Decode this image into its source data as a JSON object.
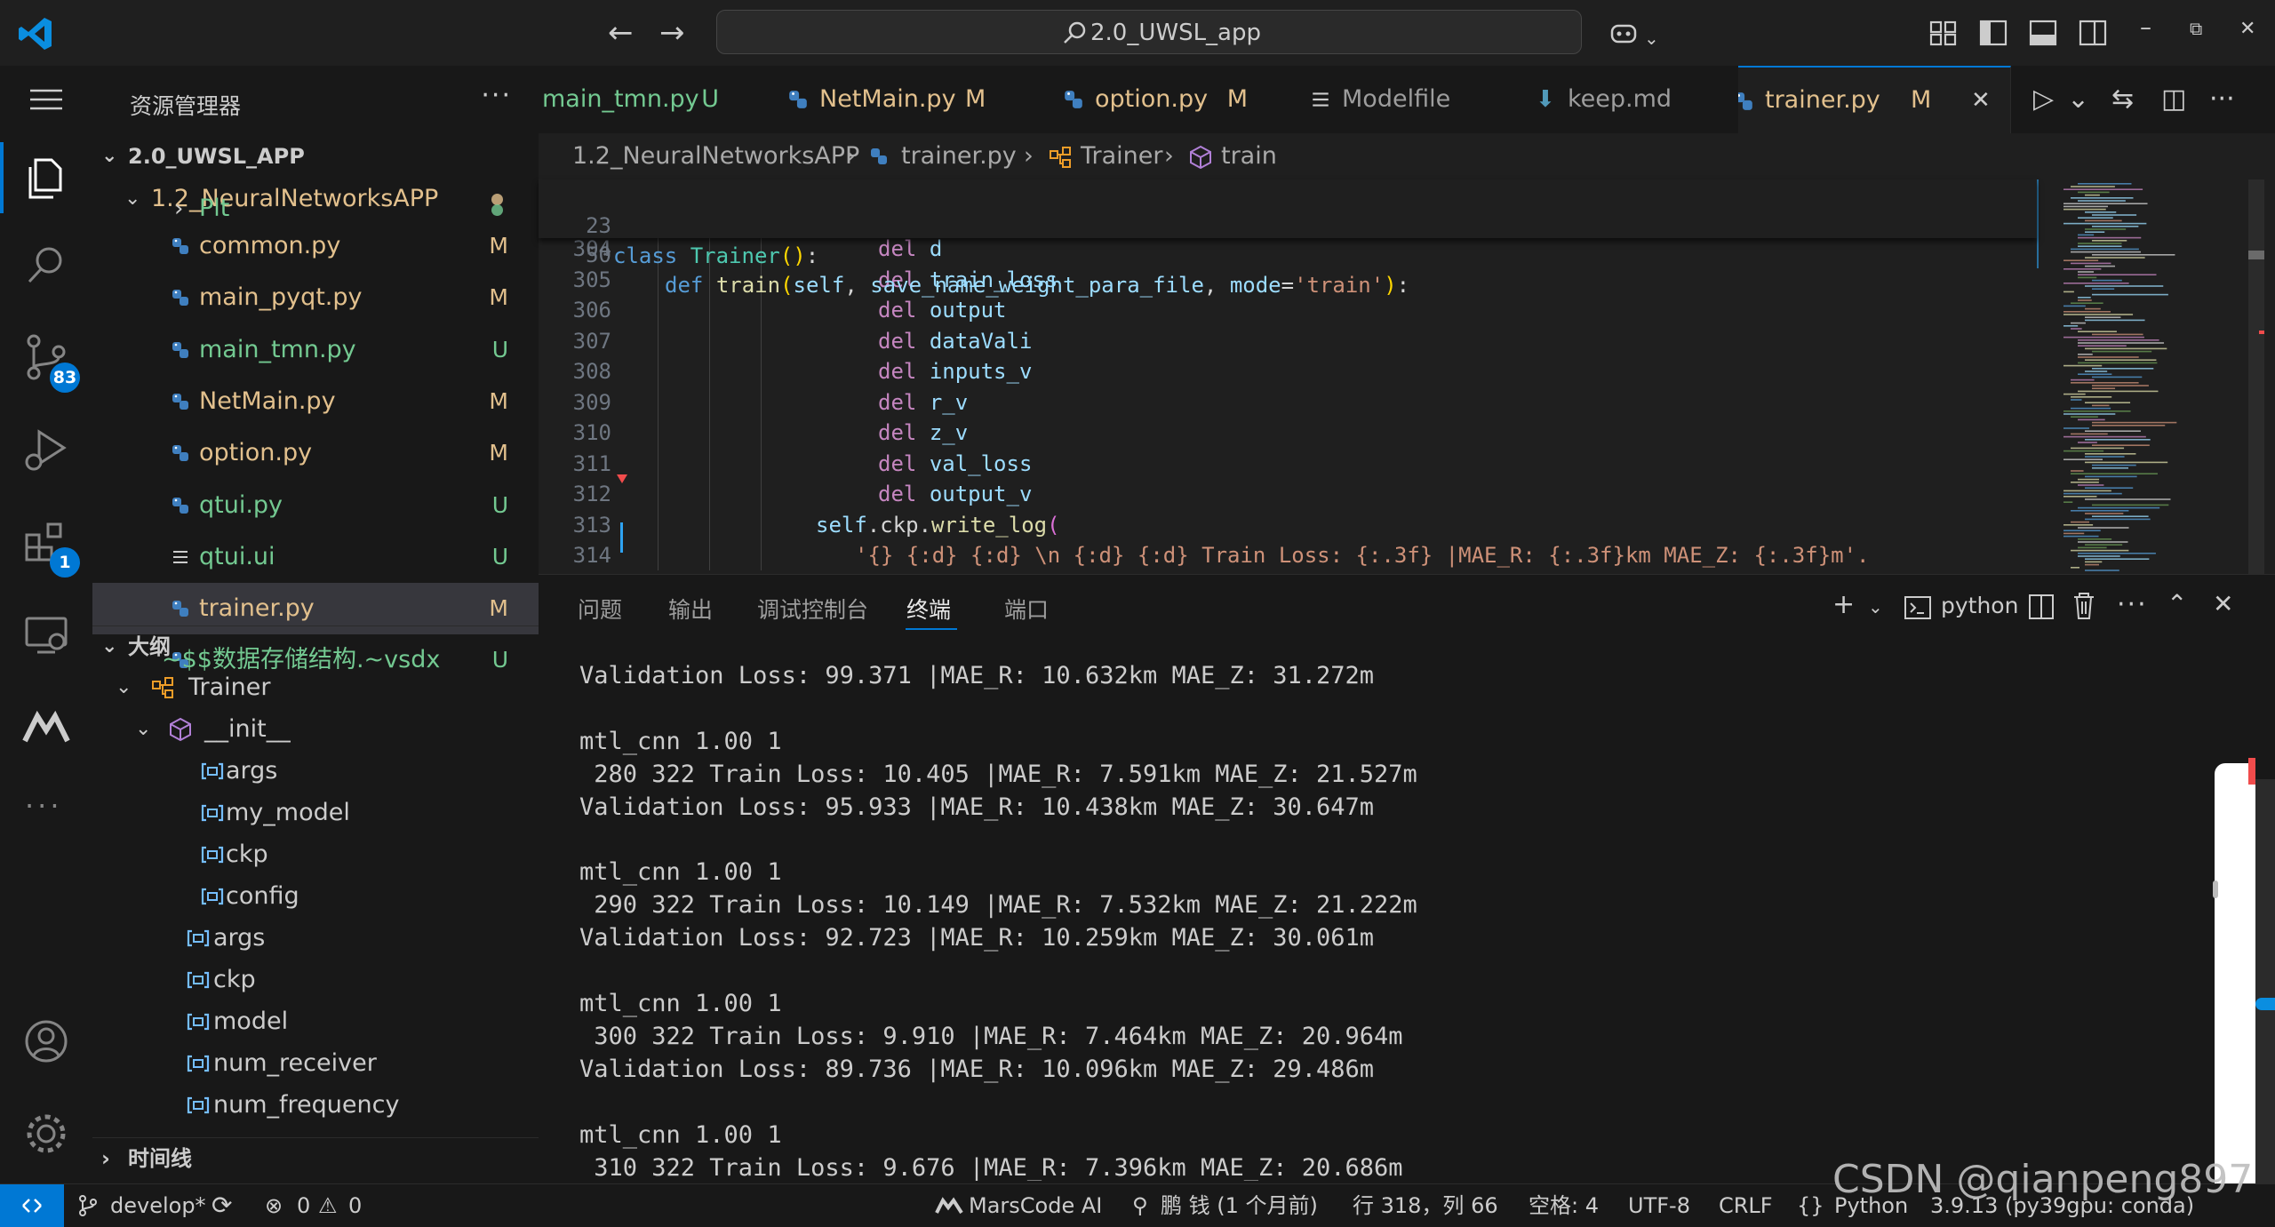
{
  "titlebar": {
    "command_center": "2.0_UWSL_app",
    "back_icon": "arrow-left-icon",
    "forward_icon": "arrow-right-icon",
    "window_minimize": "–",
    "window_restore": "⧉",
    "window_close": "✕"
  },
  "activity": {
    "scm_badge": "83",
    "extensions_badge": "1"
  },
  "sidebar": {
    "title": "资源管理器",
    "more": "···",
    "root": "2.0_UWSL_APP",
    "folder": "1.2_NeuralNetworksAPP",
    "items": [
      {
        "name": "Plt",
        "status": ""
      },
      {
        "name": "common.py",
        "status": "M"
      },
      {
        "name": "main_pyqt.py",
        "status": "M"
      },
      {
        "name": "main_tmn.py",
        "status": "U"
      },
      {
        "name": "NetMain.py",
        "status": "M"
      },
      {
        "name": "option.py",
        "status": "M"
      },
      {
        "name": "qtui.py",
        "status": "U"
      },
      {
        "name": "qtui.ui",
        "status": "U"
      },
      {
        "name": "trainer.py",
        "status": "M"
      },
      {
        "name": "~$$数据存储结构.~vsdx",
        "status": "U"
      }
    ],
    "outline_title": "大纲",
    "outline": {
      "class_name": "Trainer",
      "init_name": "__init__",
      "init_vars": [
        "args",
        "my_model",
        "ckp",
        "config"
      ],
      "members": [
        "args",
        "ckp",
        "model",
        "num_receiver",
        "num_frequency"
      ]
    },
    "timeline_title": "时间线"
  },
  "tabs": [
    {
      "name": "main_tmn.py",
      "status": "U"
    },
    {
      "name": "NetMain.py",
      "status": "M"
    },
    {
      "name": "option.py",
      "status": "M"
    },
    {
      "name": "Modelfile",
      "status": ""
    },
    {
      "name": "keep.md",
      "status": ""
    },
    {
      "name": "trainer.py",
      "status": "M",
      "close": "✕"
    }
  ],
  "breadcrumb": {
    "folder": "1.2_NeuralNetworksAPP",
    "file": "trainer.py",
    "class": "Trainer",
    "method": "train",
    "sep": "›"
  },
  "editor": {
    "sticky": [
      {
        "ln": "23",
        "code": "class Trainer():"
      },
      {
        "ln": "50",
        "code": "    def train(self, save_name_weight_para_file, mode='train'):"
      }
    ],
    "lines": [
      {
        "ln": "304",
        "kw": "del",
        "arg": "d"
      },
      {
        "ln": "305",
        "kw": "del",
        "arg": "train_loss"
      },
      {
        "ln": "306",
        "kw": "del",
        "arg": "output"
      },
      {
        "ln": "307",
        "kw": "del",
        "arg": "dataVali"
      },
      {
        "ln": "308",
        "kw": "del",
        "arg": "inputs_v"
      },
      {
        "ln": "309",
        "kw": "del",
        "arg": "r_v"
      },
      {
        "ln": "310",
        "kw": "del",
        "arg": "z_v"
      },
      {
        "ln": "311",
        "kw": "del",
        "arg": "val_loss"
      },
      {
        "ln": "312",
        "kw": "del",
        "arg": "output_v"
      }
    ],
    "line313": {
      "ln": "313",
      "self": "self",
      "rest": ".ckp.",
      "fn": "write_log",
      "paren": "("
    },
    "line314": {
      "ln": "314",
      "str": "'{} {:d} {:d} \\n {:d} {:d} Train Loss: {:.3f} |MAE_R: {:.3f}km MAE_Z: {:.3f}m'."
    }
  },
  "panel": {
    "tabs": [
      "问题",
      "输出",
      "调试控制台",
      "终端",
      "端口"
    ],
    "active_tab": "终端",
    "terminal_name": "python",
    "terminal_lines": [
      "Validation Loss: 99.371 |MAE_R: 10.632km MAE_Z: 31.272m",
      "",
      "mtl_cnn 1.00 1",
      " 280 322 Train Loss: 10.405 |MAE_R: 7.591km MAE_Z: 21.527m",
      "Validation Loss: 95.933 |MAE_R: 10.438km MAE_Z: 30.647m",
      "",
      "mtl_cnn 1.00 1",
      " 290 322 Train Loss: 10.149 |MAE_R: 7.532km MAE_Z: 21.222m",
      "Validation Loss: 92.723 |MAE_R: 10.259km MAE_Z: 30.061m",
      "",
      "mtl_cnn 1.00 1",
      " 300 322 Train Loss: 9.910 |MAE_R: 7.464km MAE_Z: 20.964m",
      "Validation Loss: 89.736 |MAE_R: 10.096km MAE_Z: 29.486m",
      "",
      "mtl_cnn 1.00 1",
      " 310 322 Train Loss: 9.676 |MAE_R: 7.396km MAE_Z: 20.686m"
    ]
  },
  "statusbar": {
    "branch": "develop*",
    "errors": "0",
    "warnings": "0",
    "marscode": "MarsCode AI",
    "blame": "鹏 钱 (1 个月前)",
    "position": "行 318，列 66",
    "spaces": "空格: 4",
    "encoding": "UTF-8",
    "eol": "CRLF",
    "language": "Python",
    "interpreter": "3.9.13 (py39gpu: conda)"
  },
  "watermark": "CSDN @qianpeng897",
  "colors": {
    "accent": "#0078d4",
    "modified": "#e2c08d",
    "untracked": "#73c991"
  }
}
